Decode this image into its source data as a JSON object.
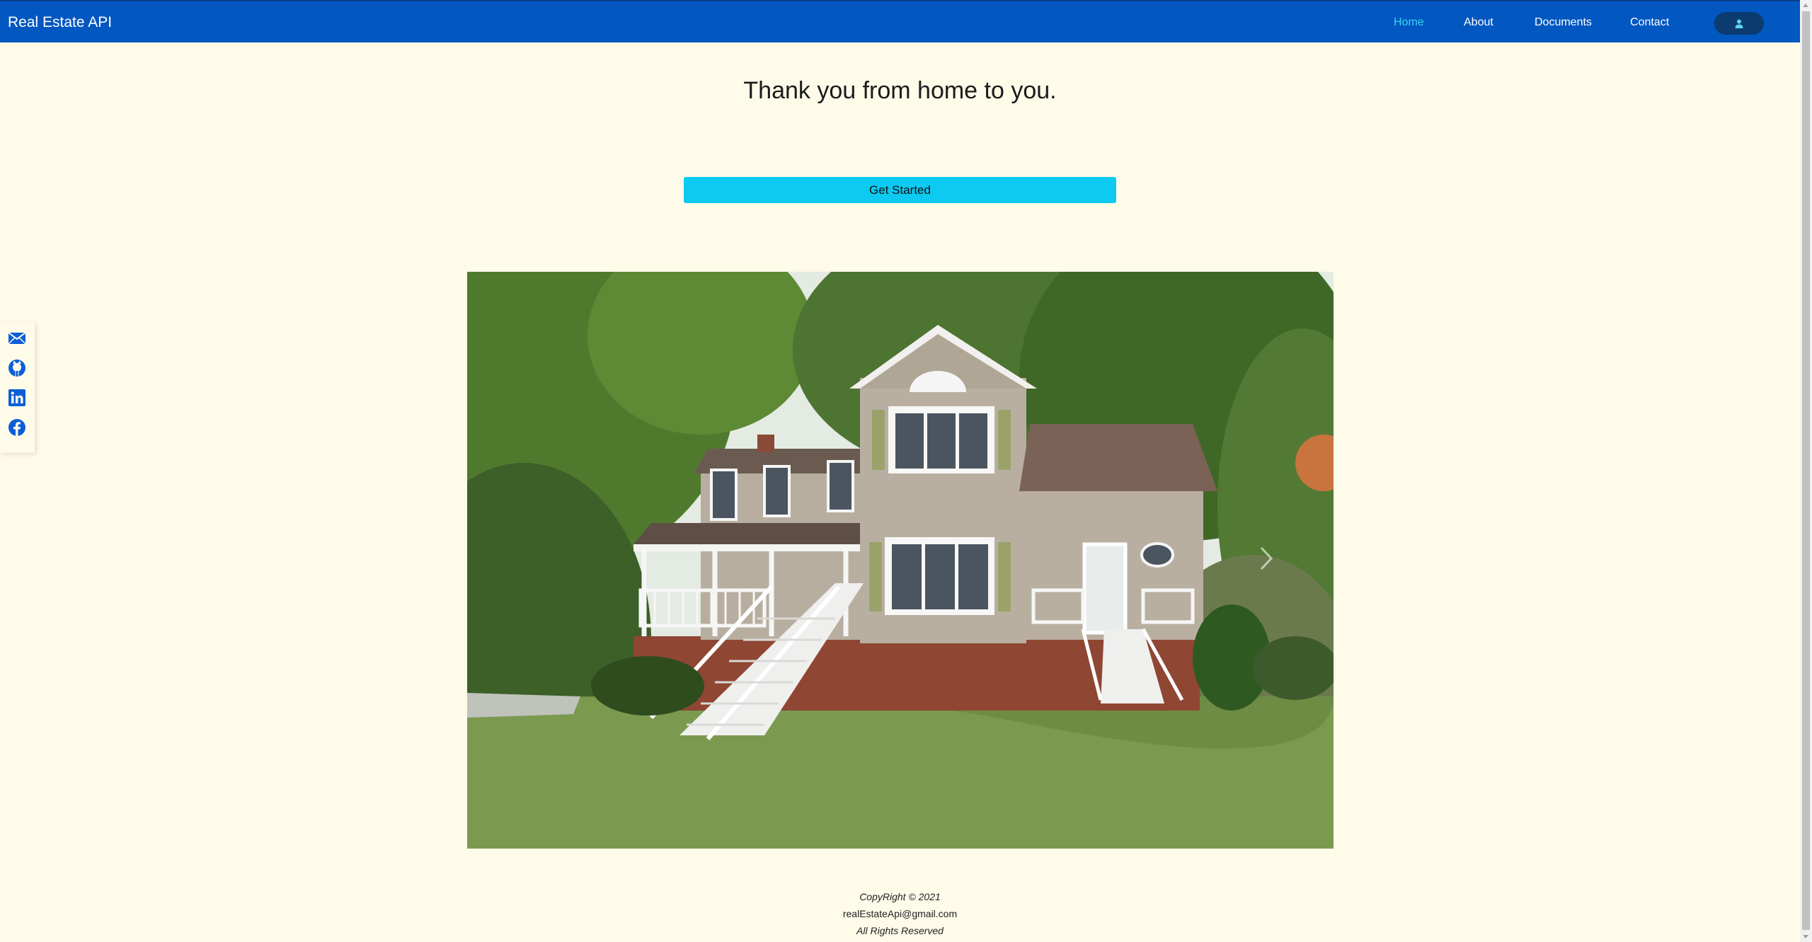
{
  "navbar": {
    "brand": "Real Estate API",
    "links": [
      {
        "label": "Home",
        "active": true
      },
      {
        "label": "About",
        "active": false
      },
      {
        "label": "Documents",
        "active": false
      },
      {
        "label": "Contact",
        "active": false
      }
    ],
    "user_icon": "user-icon"
  },
  "hero": {
    "title": "Thank you from home to you.",
    "cta_label": "Get Started"
  },
  "social": [
    "mail-icon",
    "github-icon",
    "linkedin-icon",
    "facebook-icon"
  ],
  "carousel": {
    "image": "house-photo",
    "next_icon": "chevron-right-icon"
  },
  "footer": {
    "copyright": "CopyRight © 2021",
    "email": "realEstateApi@gmail.com",
    "rights": "All Rights Reserved"
  },
  "colors": {
    "navbar_bg": "#0257c0",
    "nav_active": "#38d4f2",
    "page_bg": "#fefbe9",
    "cta_bg": "#0dcaf0",
    "user_button_bg": "#0b3b6f"
  }
}
